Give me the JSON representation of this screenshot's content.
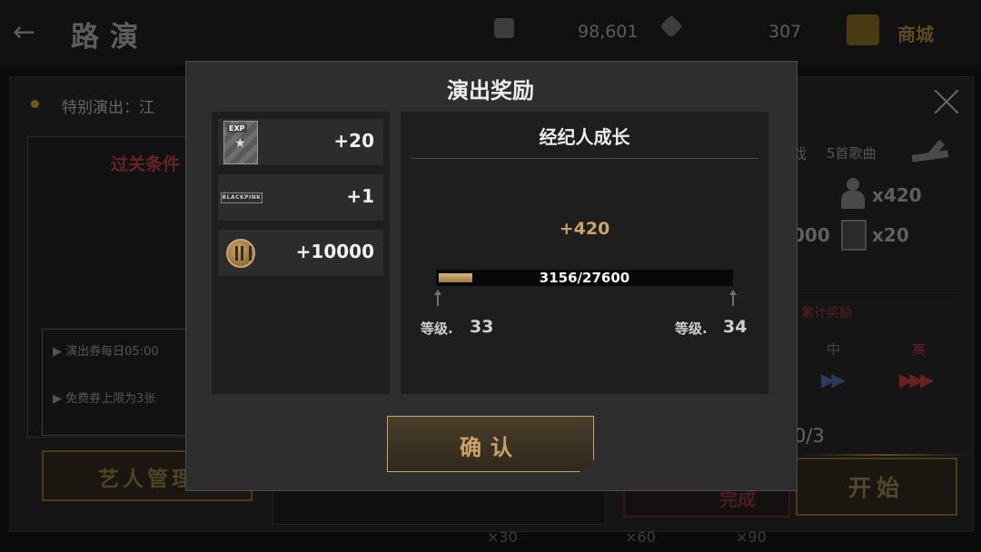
{
  "background": {
    "title": "路演",
    "resources": [
      {
        "icon": "album-icon",
        "value": "98,601"
      },
      {
        "icon": "diamond-icon",
        "value": "307"
      }
    ],
    "shop_label": "商城",
    "notice_text": "特别演出：江",
    "conditions_title": "过关条件",
    "rules": [
      "演出券每日05:00",
      "免费券上限为3张"
    ],
    "artist_button": "艺人管理",
    "songs_prefix": "戏",
    "songs_text": "5首歌曲",
    "rewards": [
      {
        "icon": "agent-exp-icon",
        "value": "x420"
      },
      {
        "icon": "exp-card-icon",
        "value": "x20"
      }
    ],
    "partial_value": "000",
    "accum_note": "累计奖励",
    "level_mid": "中",
    "level_high": "高",
    "progress_tail": "0/3",
    "start_button": "开始",
    "finish_button": "完成",
    "bottom_mults": [
      "×30",
      "×60",
      "×90"
    ]
  },
  "modal": {
    "title": "演出奖励",
    "items": [
      {
        "icon": "exp-card-icon",
        "tag": "EXP",
        "amount": "+20"
      },
      {
        "icon": "blackpink-logo",
        "logo_text": "BLACKPINK",
        "amount": "+1"
      },
      {
        "icon": "coin-icon",
        "amount": "+10000"
      }
    ],
    "growth": {
      "title": "经纪人成长",
      "gain": "+420",
      "progress_text": "3156/27600",
      "progress_fraction": 0.1144,
      "level_label": "等级.",
      "current_level": "33",
      "next_level": "34"
    },
    "confirm_label": "确认"
  },
  "colors": {
    "gold": "#c9a36a",
    "panel": "#1e1e1e",
    "modal": "#2e2e2e"
  }
}
